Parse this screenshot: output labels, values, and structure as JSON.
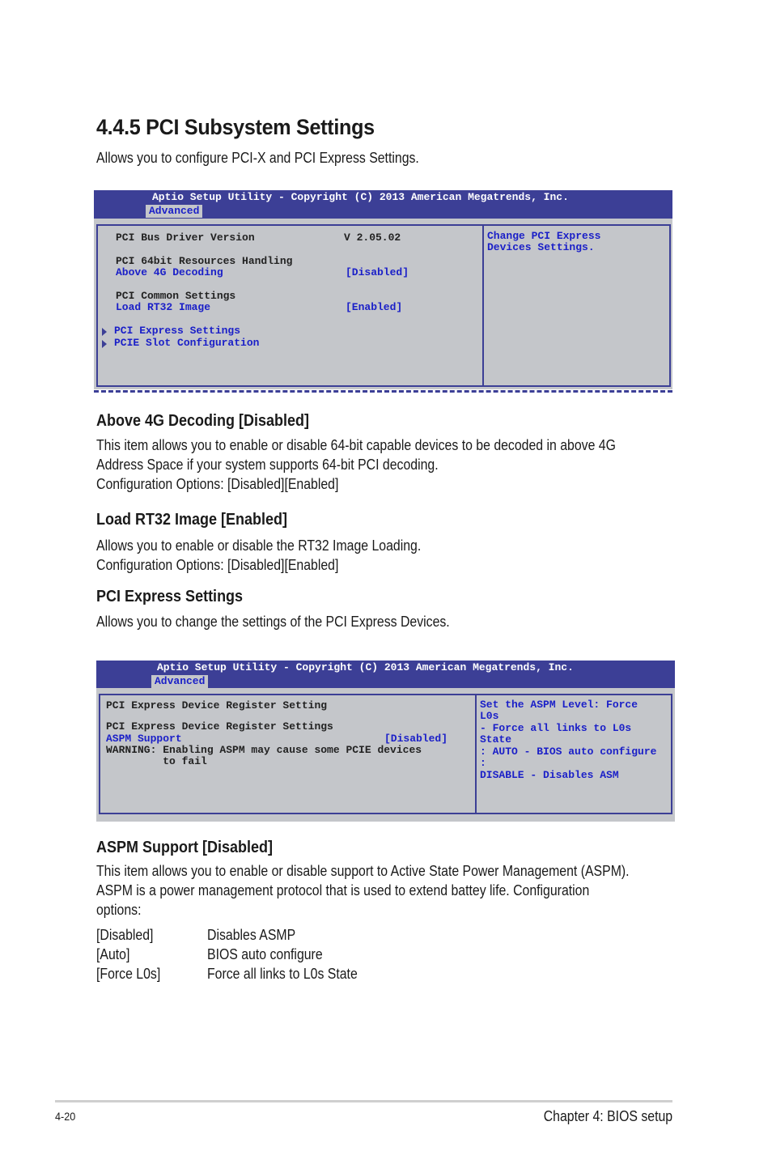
{
  "page": {
    "section_title": "4.4.5 PCI Subsystem Settings",
    "section_intro": "Allows you to configure PCI-X and PCI Express Settings."
  },
  "bios1": {
    "title": "Aptio Setup Utility - Copyright (C) 2013 American Megatrends, Inc.",
    "tab": "Advanced",
    "rows": [
      {
        "label": "PCI Bus Driver Version",
        "value": "V 2.05.02"
      },
      {
        "label": "PCI 64bit Resources Handling"
      },
      {
        "label": "Above 4G Decoding",
        "value": "[Disabled]"
      },
      {
        "label": "PCI Common Settings"
      },
      {
        "label": "Load RT32 Image",
        "value": "[Enabled]"
      }
    ],
    "submenus": [
      {
        "label": "PCI Express Settings",
        "icon": "triangle-right-icon"
      },
      {
        "label": "PCIE Slot Configuration",
        "icon": "triangle-right-icon"
      }
    ],
    "help": [
      "Change PCI Express",
      "Devices Settings."
    ]
  },
  "sections": {
    "above4g": {
      "heading": "Above 4G Decoding [Disabled]",
      "lines": [
        "This item allows you to enable or disable 64-bit capable devices to be decoded in above 4G",
        "Address Space if your system supports 64-bit PCI decoding.",
        "Configuration Options: [Disabled][Enabled]"
      ]
    },
    "rt32": {
      "heading": "Load RT32 Image [Enabled]",
      "lines": [
        "Allows you to enable or disable the RT32 Image Loading.",
        "Configuration Options: [Disabled][Enabled]"
      ]
    },
    "pcie": {
      "heading": "PCI Express Settings",
      "lines": [
        "Allows you to change the settings of the PCI Express Devices."
      ]
    },
    "aspm": {
      "heading": "ASPM Support [Disabled]",
      "lines": [
        "This item allows you to enable or disable support to Active State Power Management (ASPM).",
        "ASPM is a power management protocol that is used to extend battey life. Configuration",
        "options:"
      ],
      "options": [
        {
          "key": "[Disabled]",
          "desc": "Disables ASMP"
        },
        {
          "key": "[Auto]",
          "desc": "BIOS auto configure"
        },
        {
          "key": "[Force L0s]",
          "desc": "Force all links to L0s State"
        }
      ]
    }
  },
  "bios2": {
    "title": "Aptio Setup Utility - Copyright (C) 2013 American Megatrends, Inc.",
    "tab": "Advanced",
    "heading1": "PCI Express Device Register Setting",
    "heading2": "PCI Express Device Register Settings",
    "item": {
      "label": "ASPM Support",
      "value": "[Disabled]"
    },
    "warning": [
      "WARNING: Enabling ASPM may cause some PCIE devices",
      "         to fail"
    ],
    "help": [
      "Set the ASPM Level: Force",
      "L0s",
      "- Force all links to L0s",
      "State",
      ": AUTO - BIOS auto configure",
      ":",
      "DISABLE - Disables ASM"
    ]
  },
  "footer": {
    "page_number": "4-20",
    "chapter": "Chapter 4: BIOS setup"
  },
  "colors": {
    "bios_header": "#3c3f96",
    "bios_background": "#c4c6ca",
    "bios_highlight_text": "#1a1fc8"
  }
}
